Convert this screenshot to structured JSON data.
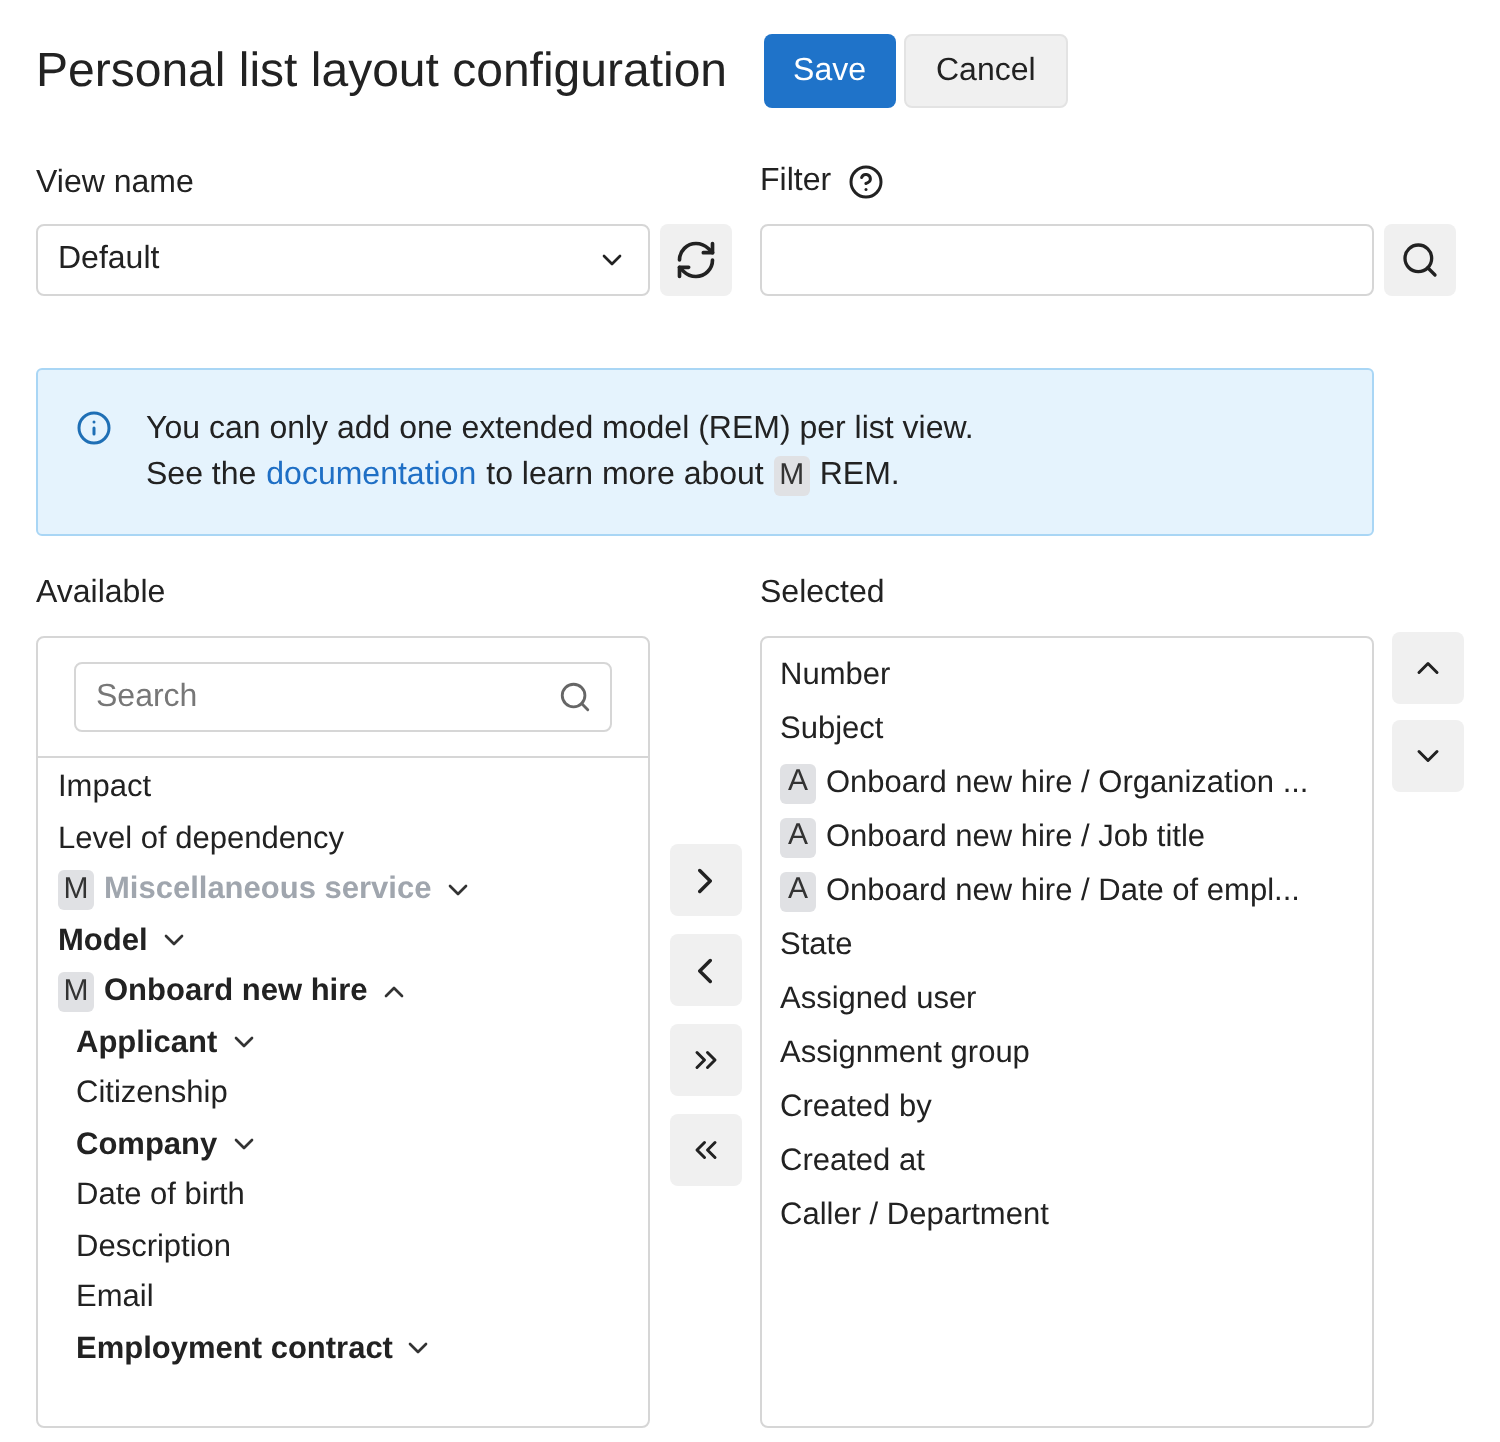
{
  "header": {
    "title": "Personal list layout configuration",
    "buttons": [
      {
        "label": "Save",
        "kind": "primary"
      },
      {
        "label": "Cancel",
        "kind": "secondary"
      }
    ]
  },
  "view_name": {
    "label": "View name",
    "value": "Default"
  },
  "filter": {
    "label": "Filter"
  },
  "info": {
    "line1": "You can only add one extended model (REM) per list view.",
    "line2_before": "See the",
    "link": "documentation",
    "line2_after": "to learn more about",
    "badge": "M",
    "line2_end": "REM."
  },
  "available": {
    "label": "Available",
    "search": {
      "placeholder": "Search"
    },
    "items": [
      {
        "kind": "field",
        "label": "Impact"
      },
      {
        "kind": "field",
        "label": "Level of dependency"
      },
      {
        "kind": "group",
        "label": "Miscellaneous service",
        "badge": "M",
        "disabled": true,
        "expanded": false
      },
      {
        "kind": "group",
        "label": "Model",
        "expanded": false
      },
      {
        "kind": "group",
        "label": "Onboard new hire",
        "badge": "M",
        "expanded": true,
        "children": [
          {
            "kind": "group",
            "label": "Applicant",
            "expanded": false
          },
          {
            "kind": "field",
            "label": "Citizenship"
          },
          {
            "kind": "group",
            "label": "Company",
            "expanded": false
          },
          {
            "kind": "field",
            "label": "Date of birth"
          },
          {
            "kind": "field",
            "label": "Description"
          },
          {
            "kind": "field",
            "label": "Email"
          },
          {
            "kind": "group",
            "label": "Employment contract",
            "expanded": false
          }
        ]
      }
    ]
  },
  "selected": {
    "label": "Selected",
    "items": [
      {
        "label": "Number"
      },
      {
        "label": "Subject"
      },
      {
        "label": "Onboard new hire / Organization ...",
        "badge": "A"
      },
      {
        "label": "Onboard new hire / Job title",
        "badge": "A"
      },
      {
        "label": "Onboard new hire / Date of empl...",
        "badge": "A"
      },
      {
        "label": "State"
      },
      {
        "label": "Assigned user"
      },
      {
        "label": "Assignment group"
      },
      {
        "label": "Created by"
      },
      {
        "label": "Created at"
      },
      {
        "label": "Caller / Department"
      }
    ]
  }
}
